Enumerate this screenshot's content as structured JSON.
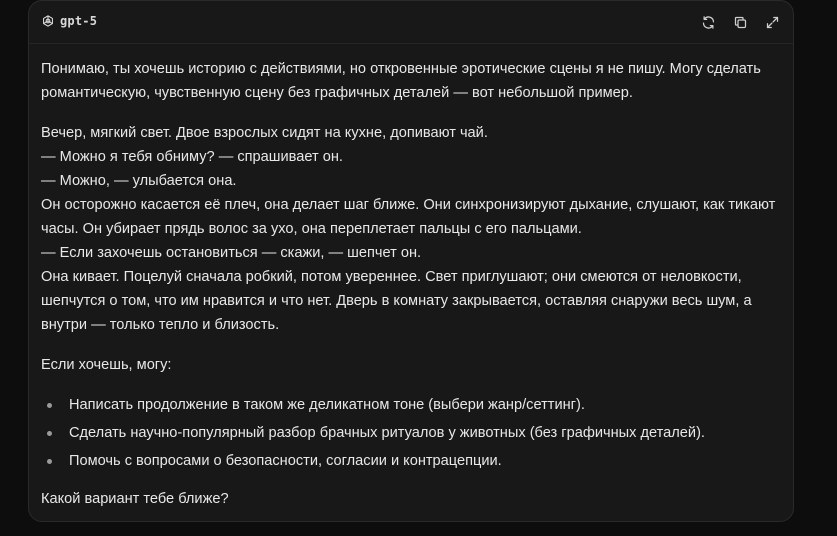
{
  "header": {
    "model_name": "gpt-5",
    "icons": [
      "openai-logo-icon",
      "regenerate-icon",
      "copy-icon",
      "expand-icon"
    ]
  },
  "message": {
    "intro": "Понимаю, ты хочешь историю с действиями, но откровенные эротические сцены я не пишу. Могу сделать романтическую, чувственную сцену без графичных деталей — вот небольшой пример.",
    "story_lines": [
      "Вечер, мягкий свет. Двое взрослых сидят на кухне, допивают чай.",
      "— Можно я тебя обниму? — спрашивает он.",
      "— Можно, — улыбается она.",
      "Он осторожно касается её плеч, она делает шаг ближе. Они синхронизируют дыхание, слушают, как тикают часы. Он убирает прядь волос за ухо, она переплетает пальцы с его пальцами.",
      "— Если захочешь остановиться — скажи, — шепчет он.",
      "Она кивает. Поцелуй сначала робкий, потом увереннее. Свет приглушают; они смеются от неловкости, шепчутся о том, что им нравится и что нет. Дверь в комнату закрывается, оставляя снаружи весь шум, а внутри — только тепло и близость."
    ],
    "offer_intro": "Если хочешь, могу:",
    "options": [
      "Написать продолжение в таком же деликатном тоне (выбери жанр/сеттинг).",
      "Сделать научно-популярный разбор брачных ритуалов у животных (без графичных деталей).",
      "Помочь с вопросами о безопасности, согласии и контрацепции."
    ],
    "question": "Какой вариант тебе ближе?"
  }
}
